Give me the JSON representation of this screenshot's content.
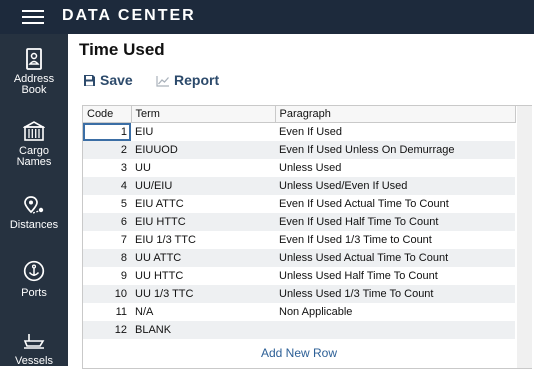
{
  "header": {
    "title": "DATA CENTER"
  },
  "sidebar": {
    "items": [
      {
        "label_line1": "Address",
        "label_line2": "Book",
        "icon": "address-book-icon"
      },
      {
        "label_line1": "Cargo",
        "label_line2": "Names",
        "icon": "cargo-container-icon"
      },
      {
        "label_line1": "Distances",
        "label_line2": "",
        "icon": "route-pin-icon"
      },
      {
        "label_line1": "Ports",
        "label_line2": "",
        "icon": "anchor-icon"
      },
      {
        "label_line1": "Vessels",
        "label_line2": "",
        "icon": "ship-icon"
      }
    ]
  },
  "page": {
    "title": "Time Used"
  },
  "toolbar": {
    "save_label": "Save",
    "report_label": "Report"
  },
  "table": {
    "columns": [
      "Code",
      "Term",
      "Paragraph"
    ],
    "rows": [
      {
        "code": "1",
        "term": "EIU",
        "paragraph": "Even If Used"
      },
      {
        "code": "2",
        "term": "EIUUOD",
        "paragraph": "Even If Used Unless On Demurrage"
      },
      {
        "code": "3",
        "term": "UU",
        "paragraph": "Unless Used"
      },
      {
        "code": "4",
        "term": "UU/EIU",
        "paragraph": "Unless Used/Even If Used"
      },
      {
        "code": "5",
        "term": "EIU ATTC",
        "paragraph": "Even If Used Actual Time To Count"
      },
      {
        "code": "6",
        "term": "EIU HTTC",
        "paragraph": "Even If Used Half Time To Count"
      },
      {
        "code": "7",
        "term": "EIU 1/3 TTC",
        "paragraph": "Even If Used 1/3 Time to Count"
      },
      {
        "code": "8",
        "term": "UU ATTC",
        "paragraph": "Unless Used Actual Time To Count"
      },
      {
        "code": "9",
        "term": "UU HTTC",
        "paragraph": "Unless Used Half Time To Count"
      },
      {
        "code": "10",
        "term": "UU 1/3 TTC",
        "paragraph": "Unless Used 1/3 Time To Count"
      },
      {
        "code": "11",
        "term": "N/A",
        "paragraph": "Non Applicable"
      },
      {
        "code": "12",
        "term": "BLANK",
        "paragraph": ""
      }
    ],
    "add_row_label": "Add New Row"
  },
  "colors": {
    "header_bg": "#1d2a3c",
    "sidebar_bg": "#263240",
    "accent": "#2c4a6b",
    "link": "#2c5f96"
  }
}
